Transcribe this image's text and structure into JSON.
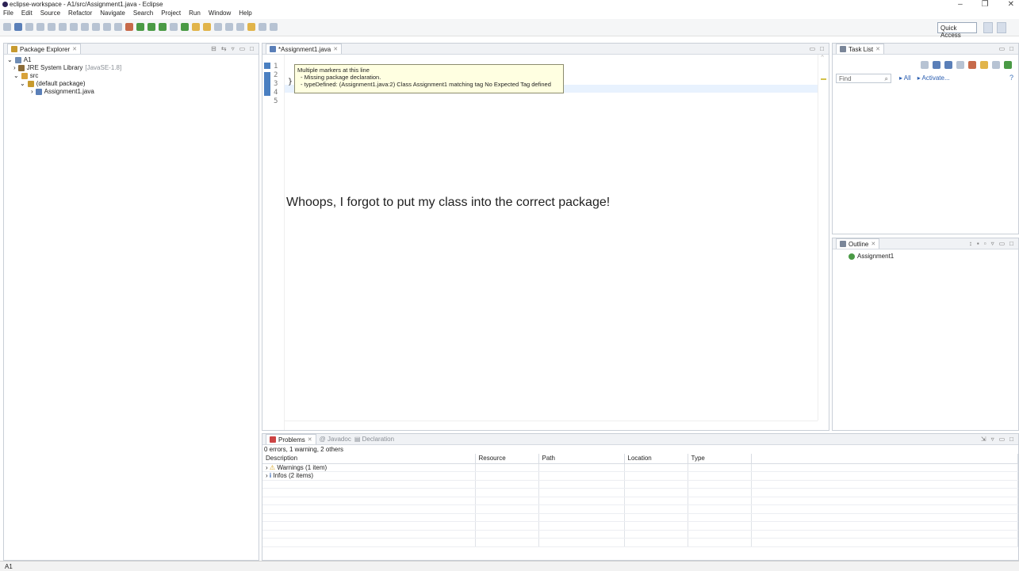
{
  "window": {
    "title": "eclipse-workspace - A1/src/Assignment1.java - Eclipse",
    "minimize": "–",
    "restore": "❐",
    "close": "✕"
  },
  "menu": [
    "File",
    "Edit",
    "Source",
    "Refactor",
    "Navigate",
    "Search",
    "Project",
    "Run",
    "Window",
    "Help"
  ],
  "toolbar": {
    "quick_access": "Quick Access"
  },
  "package_explorer": {
    "title": "Package Explorer",
    "items": {
      "project": "A1",
      "jre": "JRE System Library",
      "jre_version": "[JavaSE-1.8]",
      "src": "src",
      "default_pkg": "(default package)",
      "file": "Assignment1.java"
    }
  },
  "editor": {
    "tab": "*Assignment1.java",
    "lines": [
      "1",
      "2",
      "3",
      "4",
      "5"
    ],
    "code_line4": "}",
    "hover": {
      "line1": "Multiple markers at this line",
      "line2": "- Missing package declaration.",
      "line3": "- typeDefined: (Assignment1.java:2) Class Assignment1 matching tag No Expected Tag defined"
    },
    "caption": "Whoops, I forgot to put my class into the correct package!"
  },
  "task_list": {
    "title": "Task List",
    "find_placeholder": "Find",
    "all": "All",
    "activate": "Activate..."
  },
  "outline": {
    "title": "Outline",
    "item": "Assignment1"
  },
  "bottom": {
    "tabs": {
      "problems": "Problems",
      "javadoc": "Javadoc",
      "declaration": "Declaration"
    },
    "summary": "0 errors, 1 warning, 2 others",
    "columns": [
      "Description",
      "Resource",
      "Path",
      "Location",
      "Type"
    ],
    "rows": [
      {
        "label": "Warnings (1 item)"
      },
      {
        "label": "Infos (2 items)"
      }
    ]
  },
  "status": {
    "text": "A1"
  }
}
